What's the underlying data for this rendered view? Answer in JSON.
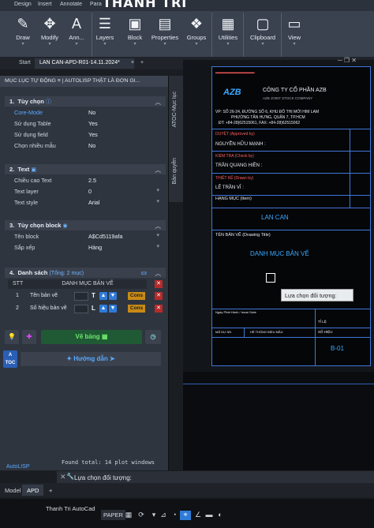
{
  "ribbon": {
    "tabs": [
      "Design",
      "Insert",
      "Annotate",
      "Para"
    ],
    "brand": "THANH TRI",
    "buttons": [
      {
        "label": "Draw",
        "icon": "pencil-icon"
      },
      {
        "label": "Modify",
        "icon": "move-icon"
      },
      {
        "label": "Ann...",
        "icon": "text-a-icon"
      },
      {
        "label": "Layers",
        "icon": "layers-icon"
      },
      {
        "label": "Block",
        "icon": "block-icon"
      },
      {
        "label": "Properties",
        "icon": "properties-icon"
      },
      {
        "label": "Groups",
        "icon": "groups-icon"
      },
      {
        "label": "Utilities",
        "icon": "utilities-icon"
      },
      {
        "label": "Clipboard",
        "icon": "clipboard-icon"
      },
      {
        "label": "View",
        "icon": "view-icon"
      }
    ]
  },
  "doc_tabs": {
    "start": "Start",
    "active": "LAN CAN-APD-R01-14.11.2024*",
    "close": "×",
    "add": "+"
  },
  "palette": {
    "title": "MỤC LỤC TỰ ĐỘNG ≡ | AUTOLISP THẬT LÀ ĐƠN GI...",
    "sections": {
      "options": {
        "title": "Tùy chọn",
        "rows": [
          {
            "label": "Core-Mode",
            "value": "No"
          },
          {
            "label": "Sử dụng Table",
            "value": "Yes"
          },
          {
            "label": "Sử dụng field",
            "value": "Yes"
          },
          {
            "label": "Chọn nhiều mẫu",
            "value": "No"
          }
        ]
      },
      "text": {
        "title": "Text",
        "rows": [
          {
            "label": "Chiều cao Text",
            "value": "2.5"
          },
          {
            "label": "Text layer",
            "value": "0"
          },
          {
            "label": "Text style",
            "value": "Arial"
          }
        ]
      },
      "block": {
        "title": "Tùy chọn block",
        "rows": [
          {
            "label": "Tên block",
            "value": "A$Cd5119afa"
          },
          {
            "label": "Sắp xếp",
            "value": "Hàng"
          }
        ]
      },
      "list": {
        "title": "Danh sách",
        "count": "(Tổng: 2 mục)",
        "header_stt": "STT",
        "header_name": "DANH MỤC BẢN VẼ",
        "rows": [
          {
            "stt": "1",
            "name": "Tên bản vẽ",
            "letter": "T",
            "cons": "Cons"
          },
          {
            "stt": "2",
            "name": "Số hiệu bản vẽ",
            "letter": "L",
            "cons": "Cons"
          }
        ]
      }
    },
    "draw_button": "Vẽ bảng",
    "guide_button": "Hướng dẫn",
    "toc_label": "TOC"
  },
  "side_strip": {
    "tab1": "ATOC-Mục lục",
    "tab2": "Bản quyền"
  },
  "sheet": {
    "company_vi": "CÔNG TY CỔ PHẦN AZB",
    "company_en": "AZB JOINT STOCK COMPANY",
    "logo": "AZB",
    "address": "VP: SỐ 26-24, ĐƯỜNG SỐ 6, KHU ĐÔ THỊ MỚI HIM LAM",
    "address2": "PHƯỜNG TÂN HƯNG, QUẬN 7, TP.HCM",
    "phone": "ĐT: +84-28)62515061, FAX: +84-28)62515062",
    "approved_label": "DUYỆT (Approved by)",
    "approved_name": "NGUYỄN HỮU MẠNH :",
    "checked_label": "KIỂM TRA (Check by)",
    "checked_name": "TRẦN QUANG HIỀN :",
    "drawn_label": "THIẾT KẾ (Drawn by)",
    "drawn_name": "LÊ TRẦN VĨ :",
    "item_label": "HẠNG MỤC (Item)",
    "item_value": "LAN CAN",
    "title_label": "TÊN BẢN VẼ (Drawing Title)",
    "title_value": "DANH MỤC BẢN VẼ",
    "date_label": "Ngày Phát Hành / Issue Date",
    "scale_label": "TỈ LỆ",
    "project_label": "MÃ DỰ ÁN",
    "file_label": "HỆ THỐNG BIỂU MẪU",
    "sheet_no_label": "SỐ HIỆU",
    "sheet_no": "B-01"
  },
  "tooltip": "Lựa chọn đối tượng:",
  "command": {
    "output": "Found total: 14 plot windows",
    "prompt": "Lựa chọn đối tượng:",
    "autolisp": "AutoLISP"
  },
  "layout_tabs": [
    "Model",
    "APD",
    "+"
  ],
  "status": {
    "app": "Thanh Tri AutoCad",
    "paper": "PAPER"
  }
}
